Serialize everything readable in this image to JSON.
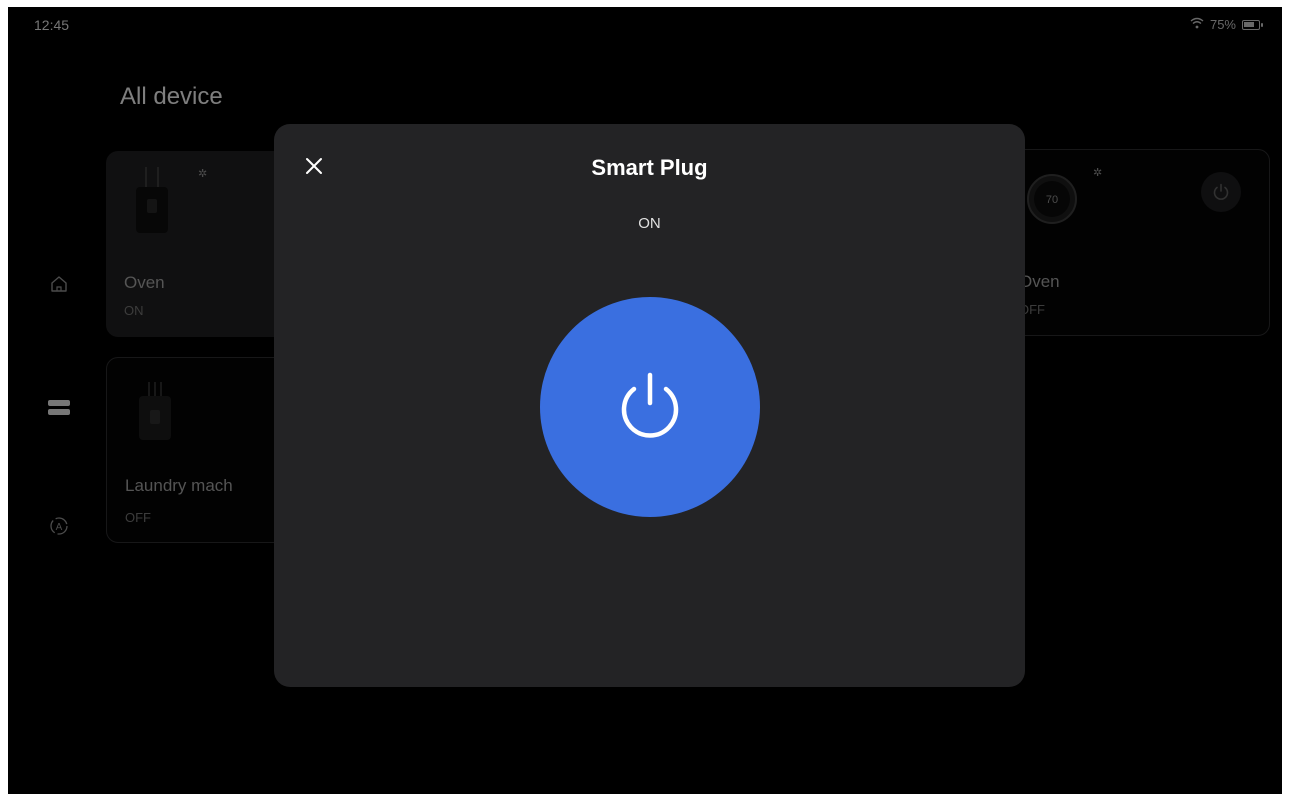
{
  "status_bar": {
    "time": "12:45",
    "battery": "75%"
  },
  "page": {
    "title": "All device"
  },
  "nav": [
    {
      "icon": "home-icon"
    },
    {
      "icon": "devices-icon"
    },
    {
      "icon": "automation-icon"
    }
  ],
  "devices": [
    {
      "name": "Oven",
      "state": "ON",
      "icon": "smart-plug-icon"
    },
    {
      "name": "Laundry mach",
      "state": "OFF",
      "icon": "smart-plug-icon"
    },
    {
      "name": "Oven",
      "state": "OFF",
      "icon": "thermostat-icon",
      "thermostat_value": "70"
    }
  ],
  "modal": {
    "title": "Smart Plug",
    "state": "ON",
    "power_color": "#3a6fe0"
  }
}
